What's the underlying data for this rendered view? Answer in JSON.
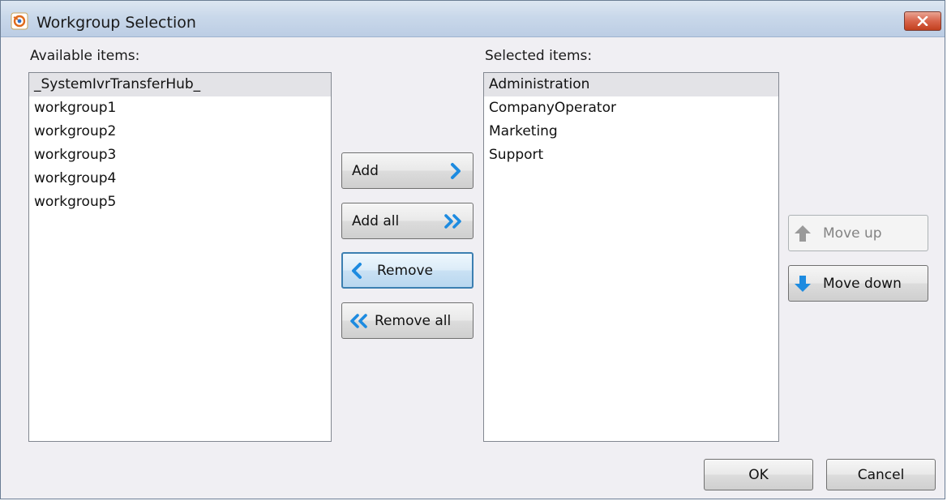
{
  "window": {
    "title": "Workgroup Selection",
    "app_icon": "app-logo-icon",
    "close_icon": "close-icon"
  },
  "available": {
    "label": "Available items:",
    "items": [
      "_SystemIvrTransferHub_",
      "workgroup1",
      "workgroup2",
      "workgroup3",
      "workgroup4",
      "workgroup5"
    ],
    "highlighted_index": 0
  },
  "selected": {
    "label": "Selected items:",
    "items": [
      "Administration",
      "CompanyOperator",
      "Marketing",
      "Support"
    ],
    "highlighted_index": 0
  },
  "buttons": {
    "add": "Add",
    "add_all": "Add all",
    "remove": "Remove",
    "remove_all": "Remove all",
    "move_up": "Move up",
    "move_down": "Move down",
    "ok": "OK",
    "cancel": "Cancel"
  },
  "colors": {
    "accent_blue": "#1d8be0",
    "disabled_gray": "#9a9a9a",
    "close_red": "#c2401f"
  }
}
